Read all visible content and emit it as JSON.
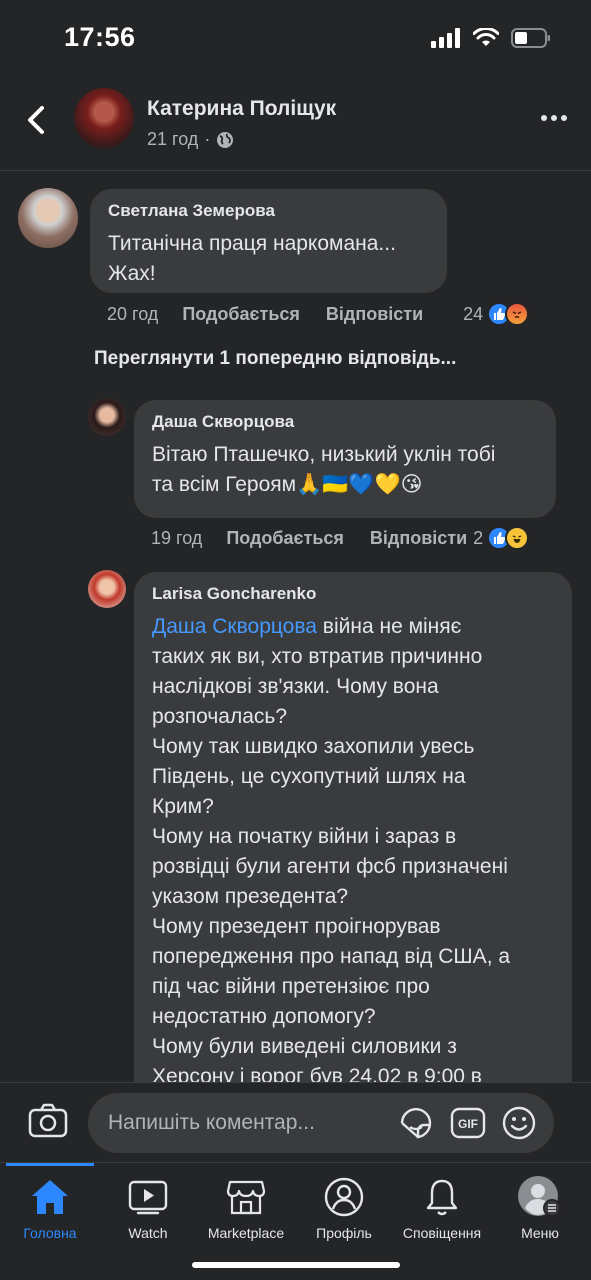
{
  "status_bar": {
    "time": "17:56"
  },
  "header": {
    "name": "Катерина Поліщук",
    "time_ago": "21 год",
    "separator": "·"
  },
  "comments": [
    {
      "author": "Светлана Земерова",
      "lines": [
        "Титанічна праця наркомана...",
        "Жах!"
      ],
      "time": "20 год",
      "like": "Подобається",
      "reply": "Відповісти",
      "reactions_count": "24",
      "reactions": [
        "like-icon",
        "angry-icon"
      ]
    }
  ],
  "view_previous": "Переглянути 1 попередню відповідь...",
  "replies": [
    {
      "author": "Даша Скворцова",
      "lines": [
        "Вітаю Пташечко, низький уклін тобі",
        "та всім Героям🙏🇺🇦💙💛😘"
      ],
      "time": "19 год",
      "like": "Подобається",
      "reply": "Відповісти",
      "reactions_count": "2",
      "reactions": [
        "like-icon",
        "haha-icon"
      ]
    },
    {
      "author": "Larisa  Goncharenko",
      "mention": "Даша Скворцова",
      "first_line_rest": " війна не міняє",
      "lines": [
        "таких як ви, хто втратив причинно",
        "наслідкові зв'язки. Чому вона",
        "розпочалась?",
        "Чому так швидко захопили увесь",
        "Південь, це сухопутний шлях на",
        "Крим?",
        "Чому на початку війни і зараз в",
        "розвідці були агенти фсб призначені",
        "указом презедента?",
        "Чому презедент проігнорував",
        "попередження про напад від США, а",
        "під час війни претензіює про",
        "недостатню допомогу?",
        "Чому були виведені силовики з",
        "Херсону і ворог був 24.02 в 9:00 в"
      ]
    }
  ],
  "composer": {
    "placeholder": "Напишіть коментар..."
  },
  "tabs": [
    {
      "label": "Головна",
      "icon": "home-icon",
      "active": true
    },
    {
      "label": "Watch",
      "icon": "watch-icon",
      "active": false
    },
    {
      "label": "Marketplace",
      "icon": "marketplace-icon",
      "active": false
    },
    {
      "label": "Профіль",
      "icon": "profile-icon",
      "active": false
    },
    {
      "label": "Сповіщення",
      "icon": "bell-icon",
      "active": false
    },
    {
      "label": "Меню",
      "icon": "menu-icon",
      "active": false
    }
  ],
  "colors": {
    "accent": "#2d88ff",
    "mention": "#4599ff",
    "bubble": "#3a3b3c",
    "background": "#242526"
  }
}
